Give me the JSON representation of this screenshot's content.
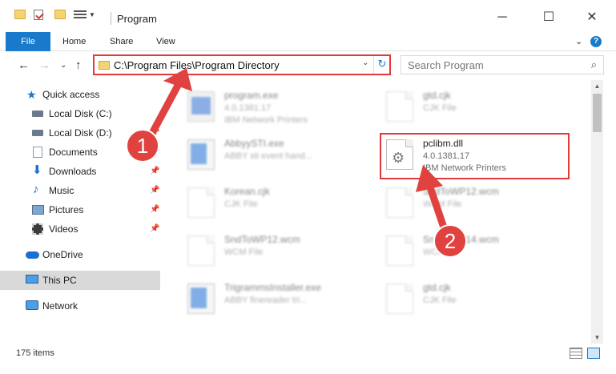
{
  "window": {
    "title": "Program",
    "minimize": "─",
    "maximize": "☐",
    "close": "✕"
  },
  "ribbon": {
    "tabs": [
      "File",
      "Home",
      "Share",
      "View"
    ],
    "expand": "⌄",
    "help": "?"
  },
  "navigation": {
    "back": "←",
    "forward": "→",
    "recent": "⌄",
    "up": "↑"
  },
  "address": {
    "path": "C:\\Program Files\\Program Directory",
    "dropdown": "⌄",
    "refresh": "↻"
  },
  "search": {
    "placeholder": "Search Program",
    "icon": "⌕"
  },
  "sidebar": {
    "items": [
      {
        "label": "Quick access",
        "icon": "star-icon",
        "pinned": false
      },
      {
        "label": "Local Disk (C:)",
        "icon": "drive-icon",
        "pinned": false
      },
      {
        "label": "Local Disk (D:)",
        "icon": "drive-icon",
        "pinned": true
      },
      {
        "label": "Documents",
        "icon": "documents-icon",
        "pinned": true
      },
      {
        "label": "Downloads",
        "icon": "downloads-icon",
        "pinned": true
      },
      {
        "label": "Music",
        "icon": "music-icon",
        "pinned": true
      },
      {
        "label": "Pictures",
        "icon": "pictures-icon",
        "pinned": true
      },
      {
        "label": "Videos",
        "icon": "videos-icon",
        "pinned": true
      },
      {
        "label": "OneDrive",
        "icon": "cloud-icon",
        "pinned": false
      },
      {
        "label": "This PC",
        "icon": "computer-icon",
        "pinned": false,
        "selected": true
      },
      {
        "label": "Network",
        "icon": "network-icon",
        "pinned": false
      }
    ]
  },
  "files": [
    {
      "name": "program.exe",
      "line1": "4.0.1381.17",
      "line2": "IBM Network Printers",
      "icon": "exe-icon"
    },
    {
      "name": "gtd.cjk",
      "line1": "CJK File",
      "line2": "",
      "icon": "document-icon"
    },
    {
      "name": "AbbyySTI.exe",
      "line1": "ABBY sti event hand...",
      "line2": "",
      "icon": "window-icon"
    },
    {
      "name": "pclibm.dll",
      "line1": "4.0.1381.17",
      "line2": "IBM Network Printers",
      "icon": "gear-document-icon",
      "highlighted": true
    },
    {
      "name": "Korean.cjk",
      "line1": "CJK File",
      "line2": "",
      "icon": "document-icon"
    },
    {
      "name": "SndToWP12.wcm",
      "line1": "WCM File",
      "line2": "",
      "icon": "document-icon"
    },
    {
      "name": "SndToWP12.wcm",
      "line1": "WCM File",
      "line2": "",
      "icon": "document-icon"
    },
    {
      "name": "SndToWP14.wcm",
      "line1": "WCM File",
      "line2": "",
      "icon": "document-icon"
    },
    {
      "name": "TrigrammsInstaller.exe",
      "line1": "ABBY finereader tri...",
      "line2": "",
      "icon": "window-icon"
    },
    {
      "name": "gtd.cjk",
      "line1": "CJK File",
      "line2": "",
      "icon": "document-icon"
    }
  ],
  "annotations": {
    "step1": "1",
    "step2": "2",
    "color": "#e0423f"
  },
  "status": {
    "item_count": "175 items"
  },
  "colors": {
    "accent": "#1979ca",
    "highlight_border": "#e23a3a",
    "selected_nav": "#d9d9d9"
  }
}
